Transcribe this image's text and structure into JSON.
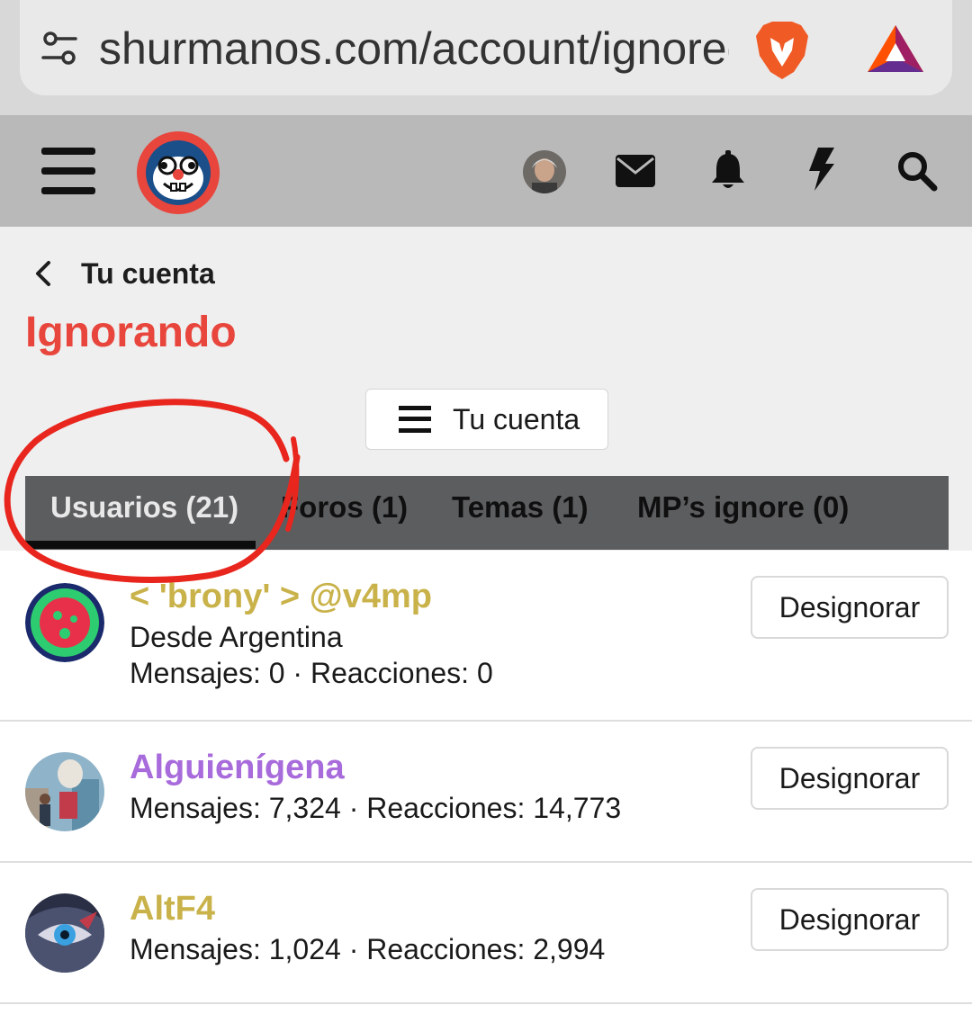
{
  "browser": {
    "url": "shurmanos.com/account/ignored",
    "icons": [
      "tune-icon",
      "brave-lion-icon",
      "bat-triangle-icon"
    ]
  },
  "header": {
    "icons": [
      "hamburger-menu-icon",
      "site-logo",
      "user-avatar",
      "mail-icon",
      "bell-icon",
      "bolt-icon",
      "search-icon"
    ]
  },
  "breadcrumb": {
    "label": "Tu cuenta"
  },
  "page": {
    "title": "Ignorando"
  },
  "account_menu": {
    "label": "Tu cuenta"
  },
  "tabs": [
    {
      "label": "Usuarios (21)",
      "active": true
    },
    {
      "label": "Foros (1)",
      "active": false
    },
    {
      "label": "Temas (1)",
      "active": false
    },
    {
      "label": "MP’s ignore (0)",
      "active": false
    }
  ],
  "users": [
    {
      "name": "< 'brony' > @v4mp",
      "location": "Desde Argentina",
      "stats": "Mensajes: 0 · Reacciones: 0",
      "button": "Designorar",
      "name_color": "#c9b24a"
    },
    {
      "name": "Alguienígena",
      "stats": "Mensajes: 7,324 · Reacciones: 14,773",
      "button": "Designorar",
      "name_color": "#a86bdb"
    },
    {
      "name": "AltF4",
      "stats": "Mensajes: 1,024 · Reacciones: 2,994",
      "button": "Designorar",
      "name_color": "#c9b24a"
    }
  ],
  "colors": {
    "accent": "#e8453c",
    "tab_bar": "#5b5d5f",
    "header": "#b9b9b9"
  }
}
